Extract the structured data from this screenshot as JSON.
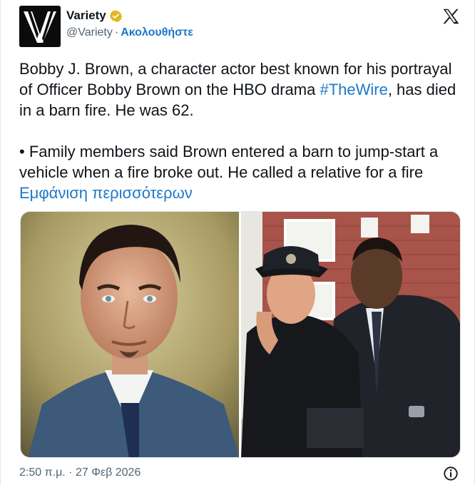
{
  "account": {
    "name": "Variety",
    "handle": "@Variety",
    "separator": "·",
    "follow_label": "Ακολουθήστε",
    "avatar_letter": "V"
  },
  "post": {
    "line1_before": "Bobby J. Brown, a character actor best known for his portrayal of Officer Bobby Brown on the HBO drama ",
    "hashtag": "#TheWire",
    "line1_after": ", has died in a barn fire. He was 62.",
    "line2": "• Family members said Brown entered a barn to jump-start a vehicle when a fire broke out. He called a relative for a fire ",
    "show_more": "Εμφάνιση περισσότερων"
  },
  "timestamp": "2:50 π.μ. · 27 Φεβ 2026",
  "icons": {
    "verified": "verified-badge-icon",
    "platform": "x-logo-icon",
    "info": "info-icon"
  },
  "colors": {
    "link": "#1d78c8",
    "verified": "#e2b719",
    "text": "#0f1419",
    "muted": "#536471"
  }
}
